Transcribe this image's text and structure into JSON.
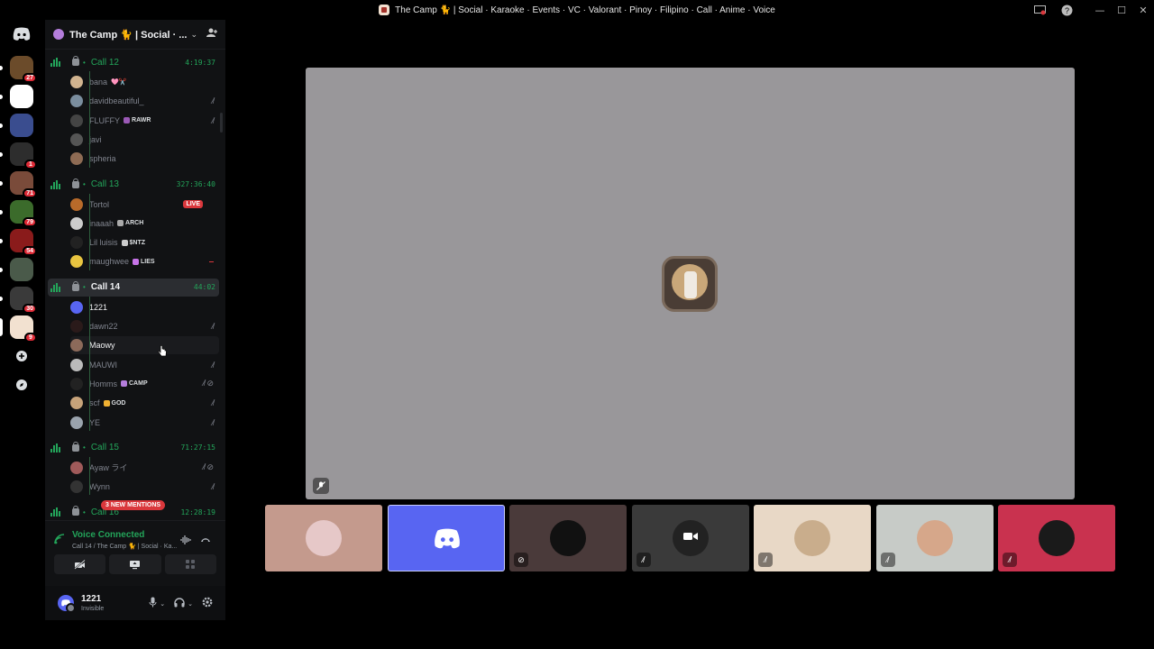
{
  "window": {
    "title": "The Camp 🐈 | Social · Karaoke · Events · VC · Valorant · Pinoy · Filipino · Call · Anime · Voice",
    "controls": [
      "—",
      "☐",
      "✕"
    ]
  },
  "rail": {
    "servers": [
      {
        "color": "#6b4b2a",
        "badge": "27"
      },
      {
        "color": "#ffffff",
        "badge": ""
      },
      {
        "color": "#3a4d8f",
        "badge": ""
      },
      {
        "color": "#2d2d2d",
        "badge": "1"
      },
      {
        "color": "#7a4b3a",
        "badge": "71"
      },
      {
        "color": "#3b6b2b",
        "badge": "79"
      },
      {
        "color": "#8a1b1b",
        "badge": "54"
      },
      {
        "color": "#4a5a4a",
        "badge": ""
      },
      {
        "color": "#3a3a3a",
        "badge": "30"
      },
      {
        "color": "#f2e1d0",
        "badge": "9"
      }
    ],
    "add_label": "+",
    "discover_label": "⊘"
  },
  "guild": {
    "name": "The Camp 🐈 | Social · ...",
    "chevron": "⌄",
    "invite_icon": "👤+"
  },
  "channels": [
    {
      "name": "Call 12",
      "timer": "4:19:37",
      "active": false,
      "members": [
        {
          "name": "bana",
          "tag": "",
          "tag_suffix": "🩷✂️",
          "bright": false,
          "color": "#d1b38f",
          "icons": ""
        },
        {
          "name": "davidbeautiful_",
          "tag": "",
          "tag_suffix": "",
          "bright": false,
          "color": "#7a8d9e",
          "icons": "⁄̸"
        },
        {
          "name": "FLUFFY",
          "tag": "RAWR",
          "tag_color": "#9b59b6",
          "bright": false,
          "color": "#444",
          "icons": "⁄̸"
        },
        {
          "name": "javi",
          "tag": "",
          "tag_suffix": "",
          "bright": false,
          "color": "#555",
          "icons": ""
        },
        {
          "name": "spheria",
          "tag": "",
          "tag_suffix": "",
          "bright": false,
          "color": "#8e6b54",
          "icons": ""
        }
      ]
    },
    {
      "name": "Call 13",
      "timer": "327:36:40",
      "active": false,
      "members": [
        {
          "name": "Tortol",
          "tag": "",
          "bright": false,
          "color": "#b86a2a",
          "icons": "",
          "live": "LIVE"
        },
        {
          "name": "inaaah",
          "tag": "ARCH",
          "tag_color": "#aaaaaa",
          "bright": false,
          "color": "#ccc",
          "icons": ""
        },
        {
          "name": "Lil luisis",
          "tag": "$NTZ",
          "tag_color": "#cccccc",
          "bright": false,
          "color": "#222",
          "icons": ""
        },
        {
          "name": "maughwee",
          "tag": "LIES",
          "tag_color": "#c774e8",
          "bright": false,
          "color": "#e8c440",
          "icons": "",
          "redline": true
        }
      ]
    },
    {
      "name": "Call 14",
      "timer": "44:02",
      "active": true,
      "members": [
        {
          "name": "1221",
          "tag": "",
          "bright": true,
          "color": "#5865f2",
          "icons": ""
        },
        {
          "name": "dawn22",
          "tag": "",
          "bright": false,
          "color": "#2a1a1a",
          "icons": "⁄̸"
        },
        {
          "name": "Maowy",
          "tag": "",
          "bright": true,
          "color": "#8c6a5a",
          "icons": "",
          "hover": true
        },
        {
          "name": "MAUWI",
          "tag": "",
          "bright": false,
          "color": "#bbb",
          "icons": "⁄̸"
        },
        {
          "name": "Homms",
          "tag": "CAMP",
          "tag_color": "#b57edc",
          "bright": false,
          "color": "#222",
          "icons": "⁄̸ ⊘"
        },
        {
          "name": "scf",
          "tag": "GOD",
          "tag_color": "#f0b132",
          "bright": false,
          "color": "#c7a37a",
          "icons": "⁄̸"
        },
        {
          "name": "YE",
          "tag": "",
          "bright": false,
          "color": "#9aa3ad",
          "icons": "⁄̸"
        }
      ]
    },
    {
      "name": "Call 15",
      "timer": "71:27:15",
      "active": false,
      "members": [
        {
          "name": "Ayaw ライ",
          "tag": "",
          "bright": false,
          "color": "#a05a5a",
          "icons": "⁄̸ ⊘"
        },
        {
          "name": "Wynn",
          "tag": "",
          "bright": false,
          "color": "#333",
          "icons": "⁄̸"
        }
      ]
    },
    {
      "name": "Call 16",
      "timer": "12:28:19",
      "active": false,
      "members": []
    }
  ],
  "mentions_pill": "3 NEW MENTIONS",
  "voice": {
    "status": "Voice Connected",
    "location": "Call 14 / The Camp 🐈 | Social · Ka...",
    "buttons": [
      "video-off",
      "screen-share",
      "activities"
    ]
  },
  "user": {
    "name": "1221",
    "status": "Invisible"
  },
  "stage": {
    "tiles": [
      {
        "bg": "#c49a8d",
        "avatar": "#e6c8c8",
        "mute": ""
      },
      {
        "bg": "#5865f2",
        "avatar": "",
        "mute": "",
        "selected": true
      },
      {
        "bg": "#4a3a3a",
        "avatar": "#111",
        "mute": "⊘"
      },
      {
        "bg": "#3a3a3a",
        "avatar": "#222",
        "mute": "⁄̸"
      },
      {
        "bg": "#e8d8c6",
        "avatar": "#c9ad8c",
        "mute": "⁄̸"
      },
      {
        "bg": "#c7cbc7",
        "avatar": "#d6a78a",
        "mute": "⁄̸"
      },
      {
        "bg": "#c9324f",
        "avatar": "#1a1a1a",
        "mute": "⁄̸"
      }
    ]
  }
}
